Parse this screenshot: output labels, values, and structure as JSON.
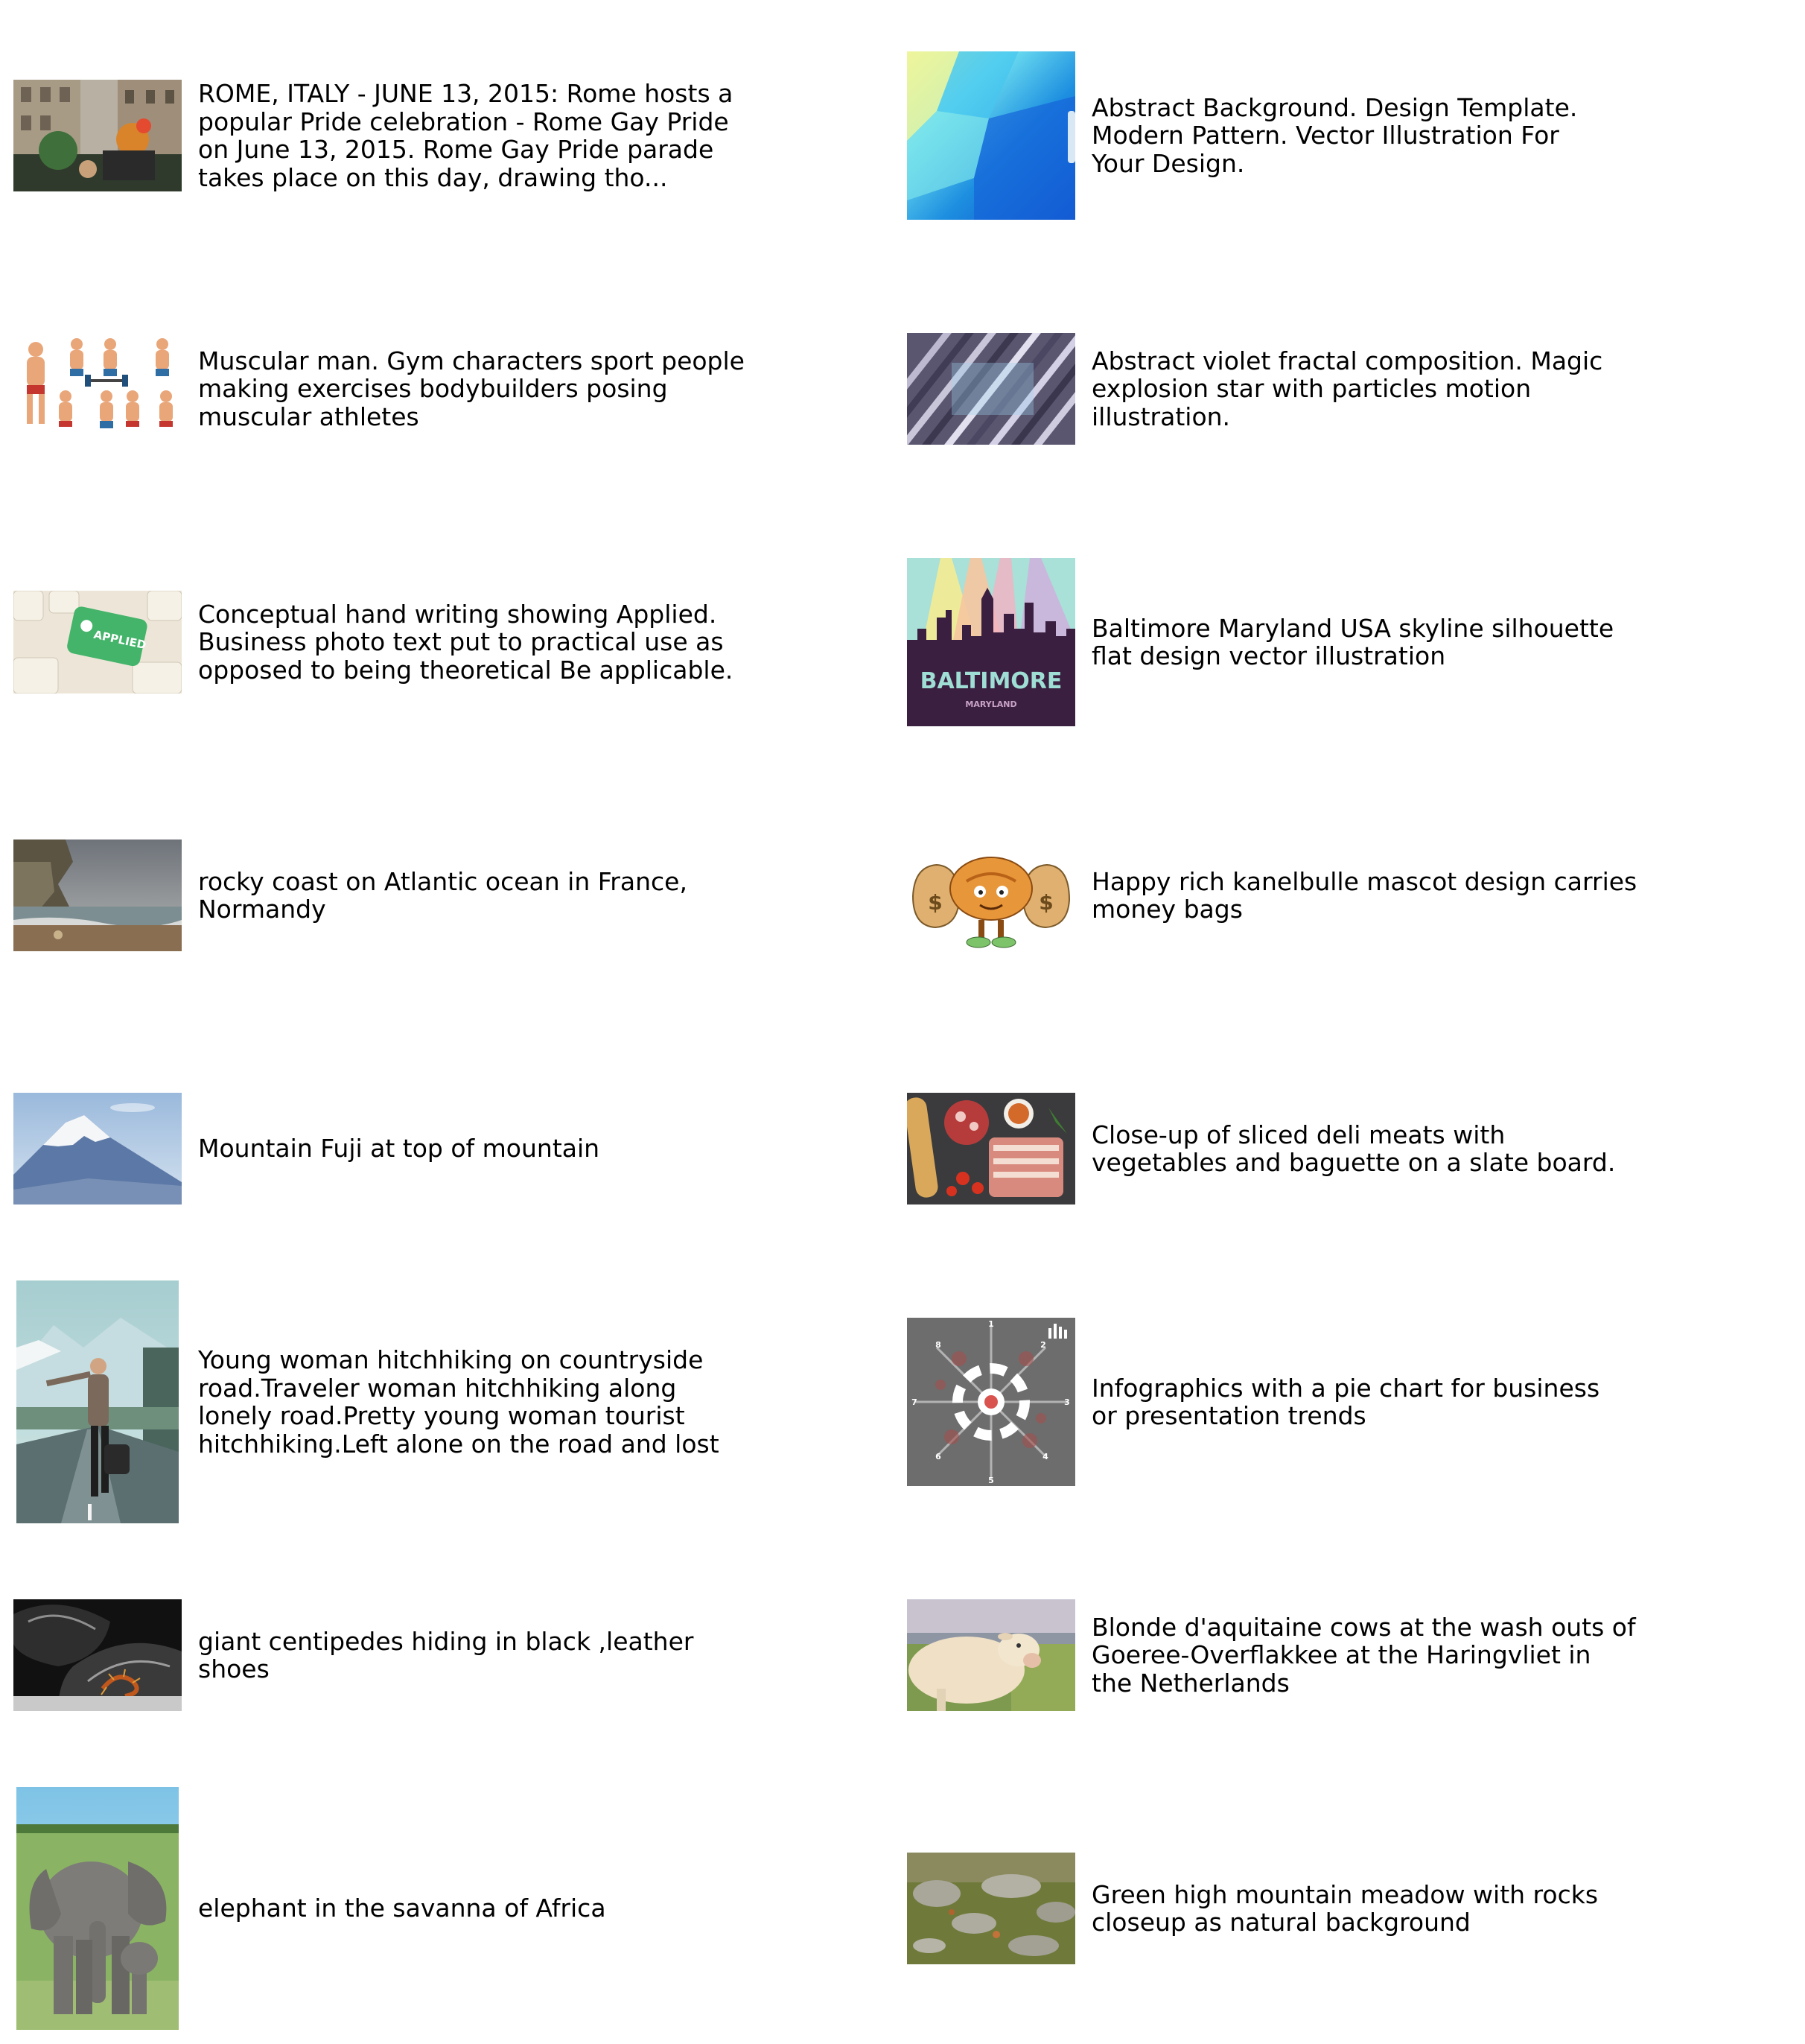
{
  "items": [
    {
      "caption": "ROME, ITALY - JUNE 13, 2015: Rome hosts a\npopular Pride celebration - Rome Gay Pride\non June 13, 2015.  Rome Gay Pride parade\ntakes place on this day, drawing tho..."
    },
    {
      "caption": "Abstract Background. Design Template.\nModern Pattern. Vector Illustration For\nYour Design."
    },
    {
      "caption": "Muscular man. Gym characters sport people\nmaking exercises bodybuilders posing\nmuscular athletes"
    },
    {
      "caption": "Abstract  violet fractal composition. Magic\nexplosion star with particles motion\nillustration."
    },
    {
      "caption": "Conceptual hand writing showing Applied.\nBusiness photo text put to practical use as\nopposed to being theoretical Be applicable.",
      "thumb_text": "APPLIED"
    },
    {
      "caption": "Baltimore Maryland USA skyline silhouette\nflat design vector illustration",
      "thumb_text": "BALTIMORE",
      "thumb_subtext": "MARYLAND"
    },
    {
      "caption": "rocky coast on Atlantic ocean in France,\nNormandy"
    },
    {
      "caption": "Happy rich kanelbulle mascot design carries\nmoney bags",
      "thumb_text": "$"
    },
    {
      "caption": "Mountain Fuji at top of mountain"
    },
    {
      "caption": "Close-up of sliced deli meats with\nvegetables and baguette on a slate board."
    },
    {
      "caption": "Young woman hitchhiking on countryside\nroad.Traveler woman hitchhiking along\nlonely road.Pretty young woman tourist\nhitchhiking.Left alone on the road and lost"
    },
    {
      "caption": "Infographics with a pie chart for business\nor presentation trends",
      "thumb_numbers": [
        "1",
        "2",
        "3",
        "4",
        "5",
        "6",
        "7",
        "8"
      ]
    },
    {
      "caption": "giant centipedes hiding in black ,leather\nshoes"
    },
    {
      "caption": "Blonde d'aquitaine cows at the wash outs of\nGoeree-Overflakkee at the Haringvliet in\nthe Netherlands"
    },
    {
      "caption": "elephant in the savanna of Africa"
    },
    {
      "caption": "Green high mountain meadow with rocks\ncloseup as natural background"
    }
  ]
}
